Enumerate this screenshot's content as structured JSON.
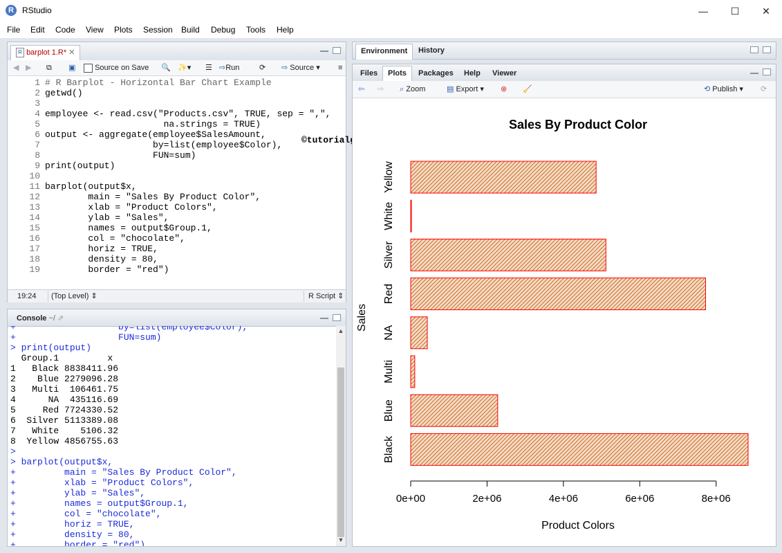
{
  "window": {
    "title": "RStudio",
    "controls": [
      "—",
      "☐",
      "✕"
    ]
  },
  "menu": [
    "File",
    "Edit",
    "Code",
    "View",
    "Plots",
    "Session",
    "Build",
    "Debug",
    "Tools",
    "Help"
  ],
  "editor": {
    "tab_label": "barplot 1.R*",
    "toolbar": {
      "source_on_save": "Source on Save",
      "run": "Run",
      "source": "Source"
    },
    "lines": [
      "# R Barplot - Horizontal Bar Chart Example",
      "getwd()",
      "",
      "employee <- read.csv(\"Products.csv\", TRUE, sep = \",\",",
      "                      na.strings = TRUE)",
      "output <- aggregate(employee$SalesAmount,",
      "                    by=list(employee$Color),",
      "                    FUN=sum)",
      "print(output)",
      "",
      "barplot(output$x,",
      "        main = \"Sales By Product Color\",",
      "        xlab = \"Product Colors\",",
      "        ylab = \"Sales\",",
      "        names = output$Group.1,",
      "        col = \"chocolate\",",
      "        horiz = TRUE,",
      "        density = 80,",
      "        border = \"red\")"
    ],
    "watermark": "©tutorialgateway.org",
    "status": {
      "position": "19:24",
      "scope": "(Top Level)",
      "type": "R Script"
    }
  },
  "console": {
    "tab_label": "Console",
    "path": "~/",
    "lines": [
      [
        "+",
        "                   by=list(employee$Color),"
      ],
      [
        "+",
        "                   FUN=sum)"
      ],
      [
        ">",
        " print(output)"
      ],
      [
        "",
        "  Group.1         x"
      ],
      [
        "",
        "1   Black 8838411.96"
      ],
      [
        "",
        "2    Blue 2279096.28"
      ],
      [
        "",
        "3   Multi  106461.75"
      ],
      [
        "",
        "4      NA  435116.69"
      ],
      [
        "",
        "5     Red 7724330.52"
      ],
      [
        "",
        "6  Silver 5113389.08"
      ],
      [
        "",
        "7   White    5106.32"
      ],
      [
        "",
        "8  Yellow 4856755.63"
      ],
      [
        ">",
        ""
      ],
      [
        ">",
        " barplot(output$x,"
      ],
      [
        "+",
        "         main = \"Sales By Product Color\","
      ],
      [
        "+",
        "         xlab = \"Product Colors\","
      ],
      [
        "+",
        "         ylab = \"Sales\","
      ],
      [
        "+",
        "         names = output$Group.1,"
      ],
      [
        "+",
        "         col = \"chocolate\","
      ],
      [
        "+",
        "         horiz = TRUE,"
      ],
      [
        "+",
        "         density = 80,"
      ],
      [
        "+",
        "         border = \"red\")"
      ]
    ]
  },
  "env_pane": {
    "tabs": [
      "Environment",
      "History"
    ]
  },
  "files_pane": {
    "tabs": [
      "Files",
      "Plots",
      "Packages",
      "Help",
      "Viewer"
    ],
    "active_tab": "Plots",
    "toolbar": {
      "zoom": "Zoom",
      "export": "Export",
      "publish": "Publish"
    }
  },
  "chart_data": {
    "type": "bar",
    "orientation": "horizontal",
    "title": "Sales By Product Color",
    "xlabel": "Product Colors",
    "ylabel": "Sales",
    "categories": [
      "Black",
      "Blue",
      "Multi",
      "NA",
      "Red",
      "Silver",
      "White",
      "Yellow"
    ],
    "values": [
      8838411.96,
      2279096.28,
      106461.75,
      435116.69,
      7724330.52,
      5113389.08,
      5106.32,
      4856755.63
    ],
    "xticks": [
      "0e+00",
      "2e+06",
      "4e+06",
      "6e+06",
      "8e+06"
    ],
    "xtick_values": [
      0,
      2000000,
      4000000,
      6000000,
      8000000
    ],
    "xlim": [
      0,
      8838411.96
    ],
    "fill": "#d2691e",
    "border": "#ff0000",
    "grid": false
  }
}
